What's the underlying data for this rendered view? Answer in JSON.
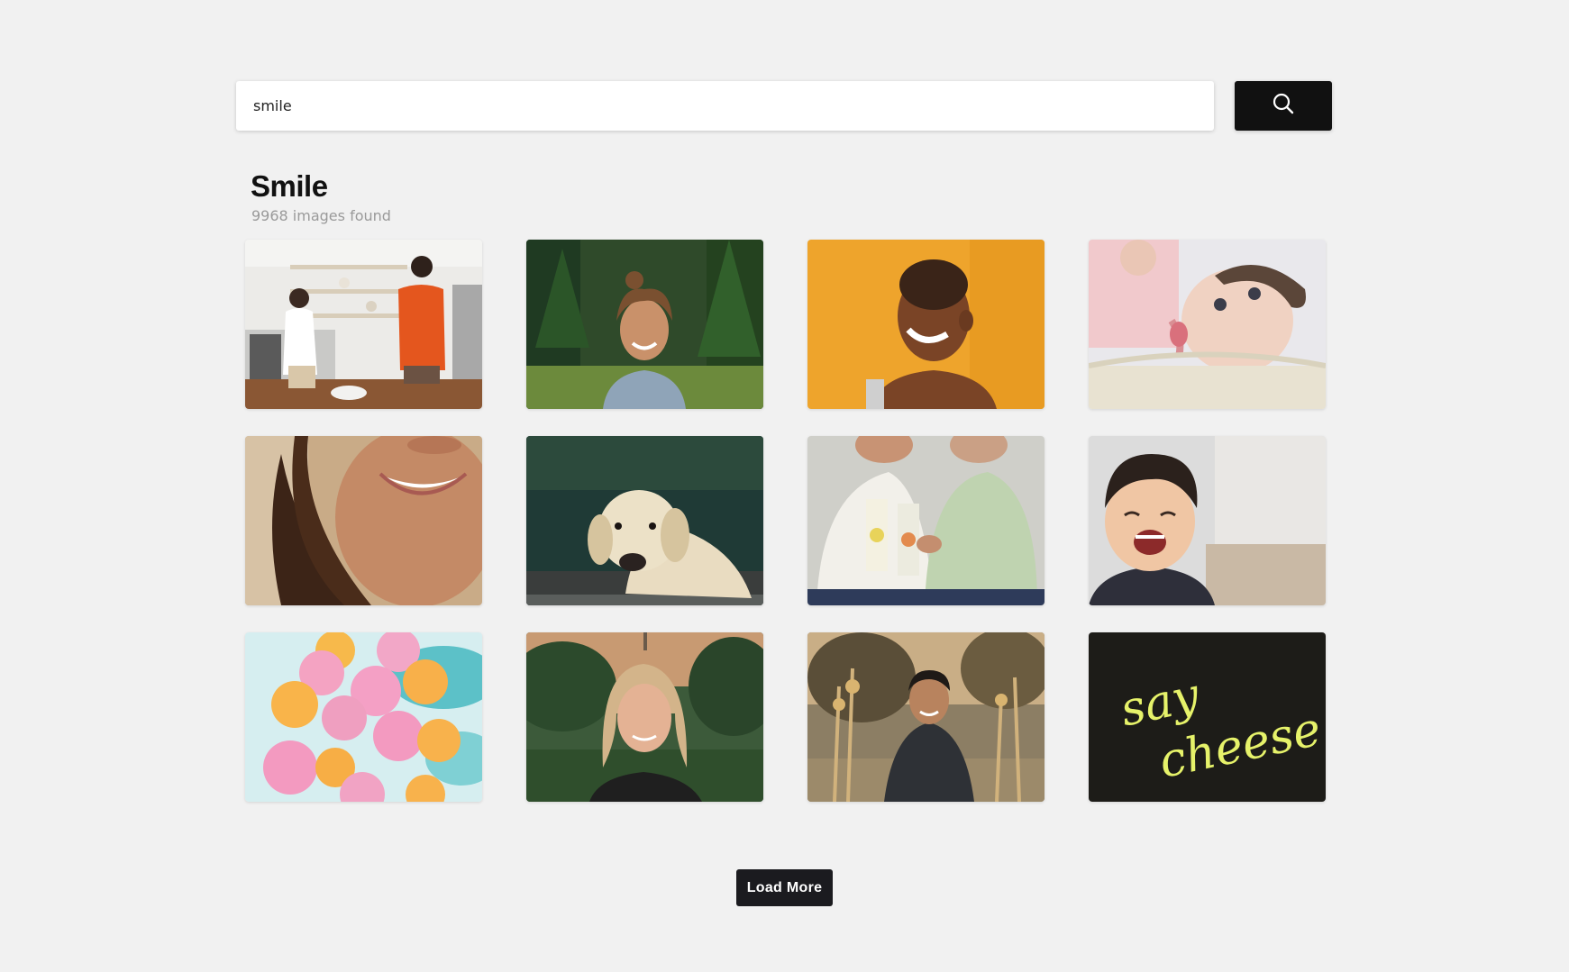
{
  "search": {
    "value": "smile",
    "button_icon": "search-icon"
  },
  "results": {
    "title": "Smile",
    "count_text": "9968 images found"
  },
  "images": [
    {
      "name": "two-women-kitchen-photo"
    },
    {
      "name": "woman-forest-laughing-photo"
    },
    {
      "name": "woman-orange-background-laughing-photo"
    },
    {
      "name": "baby-smiling-photo"
    },
    {
      "name": "woman-curly-hair-smile-photo"
    },
    {
      "name": "labrador-dog-photo"
    },
    {
      "name": "two-women-milk-cartons-photo"
    },
    {
      "name": "boy-laughing-photo"
    },
    {
      "name": "smiley-balloons-photo"
    },
    {
      "name": "blonde-woman-portrait-photo"
    },
    {
      "name": "man-outdoors-smiling-photo"
    },
    {
      "name": "neon-text-photo",
      "neon_text_line1": "say",
      "neon_text_line2": "cheese"
    }
  ],
  "load_more": {
    "label": "Load More"
  },
  "colors": {
    "background": "#f1f1f1",
    "button_dark": "#111111",
    "subtitle_gray": "#9a9a9a",
    "neon_yellow": "#e6f26a"
  }
}
